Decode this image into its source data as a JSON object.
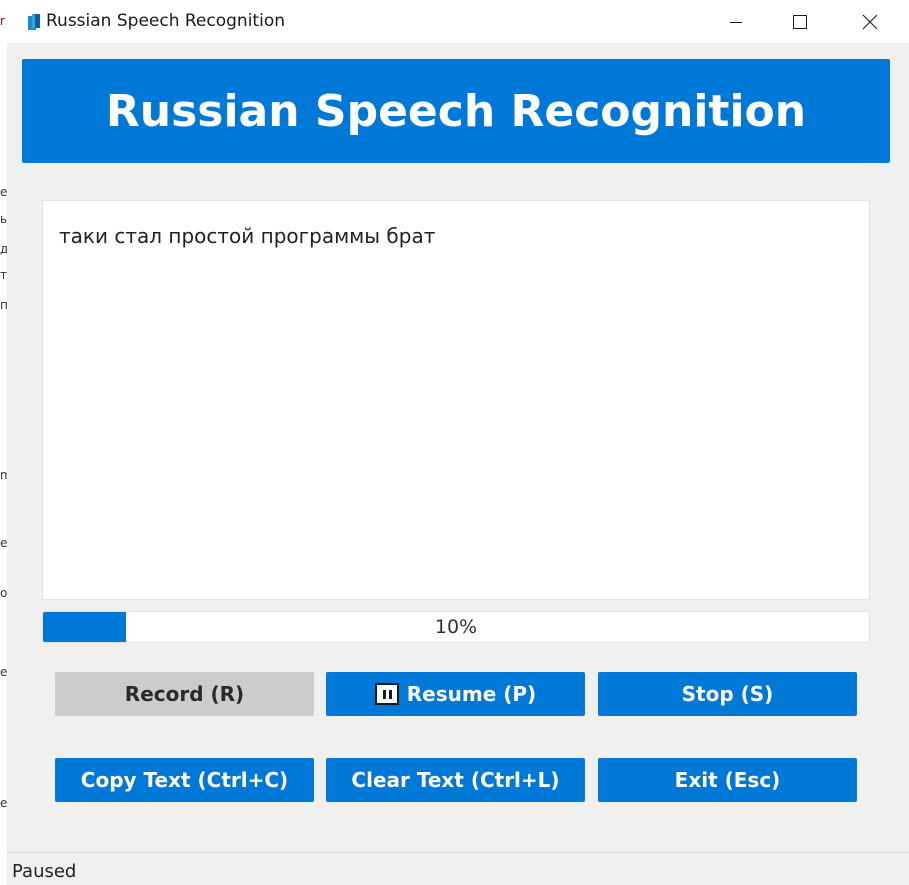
{
  "window": {
    "title": "Russian Speech Recognition"
  },
  "banner": {
    "title": "Russian Speech Recognition"
  },
  "transcript": {
    "text": "таки стал простой программы брат"
  },
  "progress": {
    "value_percent": 10,
    "label": "10%"
  },
  "buttons": {
    "record": "Record (R)",
    "resume": "Resume (P)",
    "stop": "Stop (S)",
    "copy": "Copy Text (Ctrl+C)",
    "clear": "Clear Text (Ctrl+L)",
    "exit": "Exit (Esc)"
  },
  "status": {
    "text": "Paused"
  },
  "icons": {
    "app": "microphone-app-icon",
    "minimize": "minimize-icon",
    "maximize": "maximize-icon",
    "close": "close-icon",
    "pause": "pause-icon"
  },
  "colors": {
    "accent": "#0078d7",
    "disabled_button": "#cccccc",
    "window_bg": "#f0f0f0"
  }
}
